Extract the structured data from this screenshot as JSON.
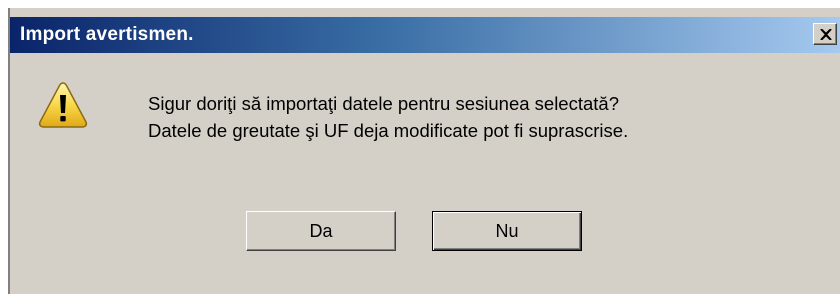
{
  "dialog": {
    "title": "Import avertismen.",
    "close_label": "✕",
    "icon": "warning-icon",
    "message_line1": "Sigur doriţi să importaţi datele pentru sesiunea selectată?",
    "message_line2": "Datele de greutate şi UF deja modificate pot fi suprascrise.",
    "buttons": {
      "yes_label": "Da",
      "no_label": "Nu"
    }
  },
  "colors": {
    "titlebar_start": "#0a246a",
    "titlebar_end": "#a6caf0",
    "dialog_bg": "#d4d0c8",
    "warning_yellow": "#f8d848"
  }
}
